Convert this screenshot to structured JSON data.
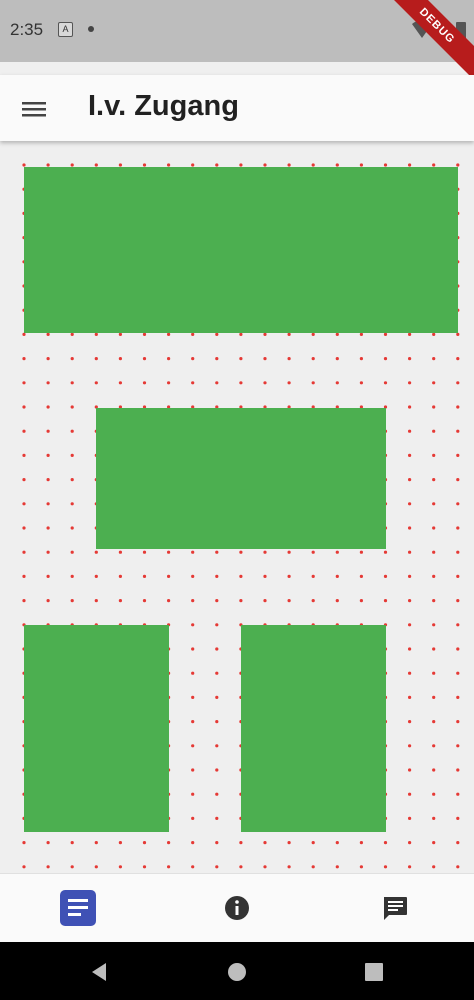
{
  "status_bar": {
    "time": "2:35",
    "a_icon": "A",
    "debug_label": "DEBUG"
  },
  "app_bar": {
    "title": "I.v. Zugang"
  },
  "icons": {
    "menu": "menu-icon",
    "documents": "document-list-icon",
    "info": "info-icon",
    "chat": "chat-icon",
    "back": "back-triangle-icon",
    "home": "home-circle-icon",
    "recents": "recents-square-icon"
  },
  "colors": {
    "green_box": "#4caf50",
    "dot": "#e53935",
    "active_nav": "#3f51b5",
    "background": "#efefef"
  },
  "bottom_nav": {
    "active_index": 0
  }
}
